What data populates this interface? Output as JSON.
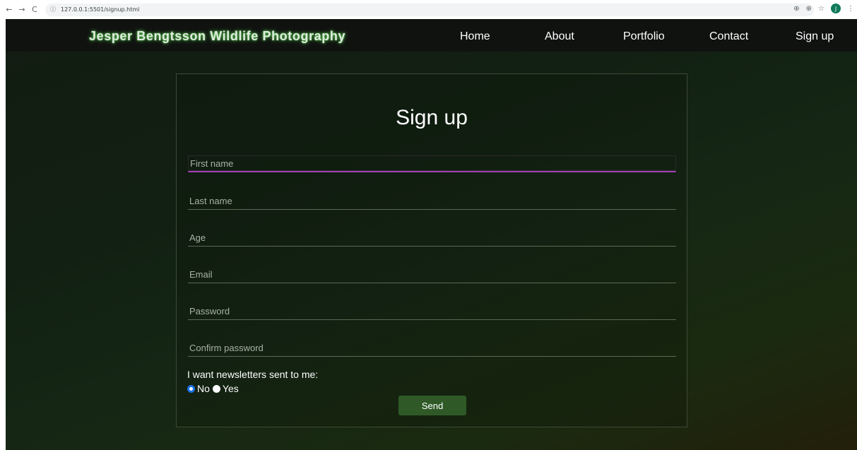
{
  "browser": {
    "url": "127.0.0.1:5501/signup.html",
    "back": "←",
    "forward": "→",
    "reload": "C",
    "info": "ⓘ",
    "translate": "⊕",
    "zoom": "⊕",
    "star": "☆",
    "avatar_letter": "J",
    "menu": "⋮"
  },
  "navbar": {
    "logo": "Jesper Bengtsson Wildlife Photography",
    "links": [
      "Home",
      "About",
      "Portfolio",
      "Contact",
      "Sign up"
    ]
  },
  "form": {
    "title": "Sign up",
    "fields": [
      {
        "placeholder": "First name"
      },
      {
        "placeholder": "Last name"
      },
      {
        "placeholder": "Age"
      },
      {
        "placeholder": "Email"
      },
      {
        "placeholder": "Password"
      },
      {
        "placeholder": "Confirm password"
      }
    ],
    "newsletter_label": "I want newsletters sent to me:",
    "options": [
      {
        "label": "No",
        "checked": true
      },
      {
        "label": "Yes",
        "checked": false
      }
    ],
    "submit_label": "Send"
  },
  "colors": {
    "accent_focus": "#a13fb3",
    "button": "#2f5a27",
    "logo_glow": "#58c84f"
  }
}
